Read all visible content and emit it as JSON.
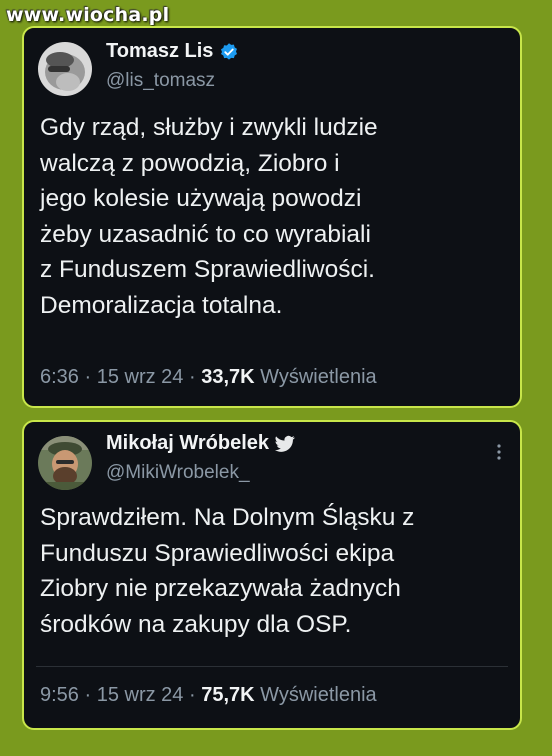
{
  "watermark": "www.wiocha.pl",
  "colors": {
    "background": "#7a9a1e",
    "card": "#0d1015",
    "border": "#c8e64a",
    "verified_blue": "#1d9bf0",
    "muted": "#8b98a5"
  },
  "tweets": [
    {
      "name": "Tomasz Lis",
      "handle": "@lis_tomasz",
      "badge_icon": "verified-badge-icon",
      "text_lines": [
        "Gdy rząd, służby i zwykli ludzie",
        "walczą z powodzią, Ziobro i",
        "jego kolesie używają powodzi",
        "żeby uzasadnić to co wyrabiali",
        "z Funduszem Sprawiedliwości.",
        "Demoralizacja totalna."
      ],
      "time": "6:36",
      "sep1": " · ",
      "date": "15 wrz 24",
      "sep2": " · ",
      "views_count": "33,7K",
      "views_label": " Wyświetlenia"
    },
    {
      "name": "Mikołaj Wróbelek",
      "handle": "@MikiWrobelek_",
      "badge_icon": "twitter-bird-icon",
      "more_icon": "more-vertical-icon",
      "text_lines": [
        "Sprawdziłem. Na Dolnym Śląsku z",
        "Funduszu Sprawiedliwości ekipa",
        "Ziobry nie przekazywała żadnych",
        "środków na zakupy dla OSP."
      ],
      "time": "9:56",
      "sep1": " · ",
      "date": "15 wrz 24",
      "sep2": " · ",
      "views_count": "75,7K",
      "views_label": " Wyświetlenia"
    }
  ]
}
